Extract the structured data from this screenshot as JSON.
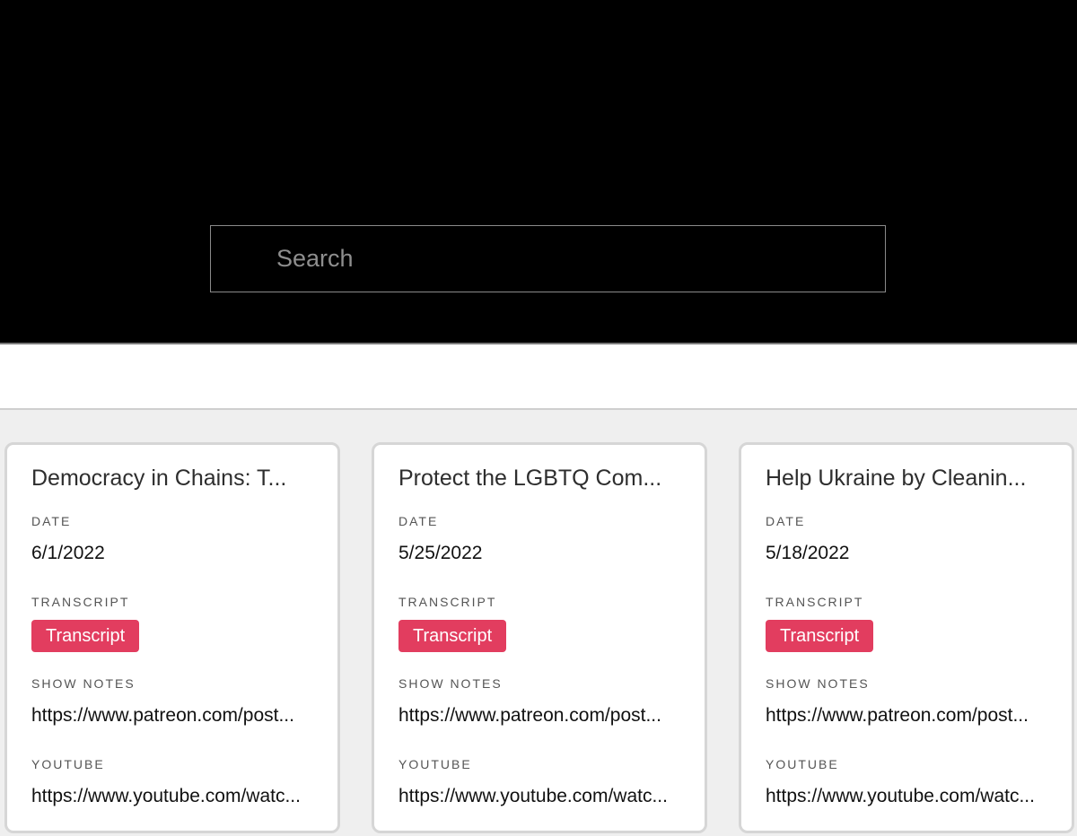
{
  "search": {
    "placeholder": "Search"
  },
  "labels": {
    "date": "DATE",
    "transcript": "TRANSCRIPT",
    "show_notes": "SHOW NOTES",
    "youtube": "YOUTUBE"
  },
  "episodes": [
    {
      "title": "Democracy in Chains: T...",
      "date": "6/1/2022",
      "transcript_button": "Transcript",
      "show_notes": "https://www.patreon.com/post...",
      "youtube": "https://www.youtube.com/watc..."
    },
    {
      "title": "Protect the LGBTQ Com...",
      "date": "5/25/2022",
      "transcript_button": "Transcript",
      "show_notes": "https://www.patreon.com/post...",
      "youtube": "https://www.youtube.com/watc..."
    },
    {
      "title": "Help Ukraine by Cleanin...",
      "date": "5/18/2022",
      "transcript_button": "Transcript",
      "show_notes": "https://www.patreon.com/post...",
      "youtube": "https://www.youtube.com/watc..."
    }
  ],
  "colors": {
    "header_bg": "#000000",
    "content_bg": "#efefef",
    "transcript_button": "#e23d5f"
  }
}
